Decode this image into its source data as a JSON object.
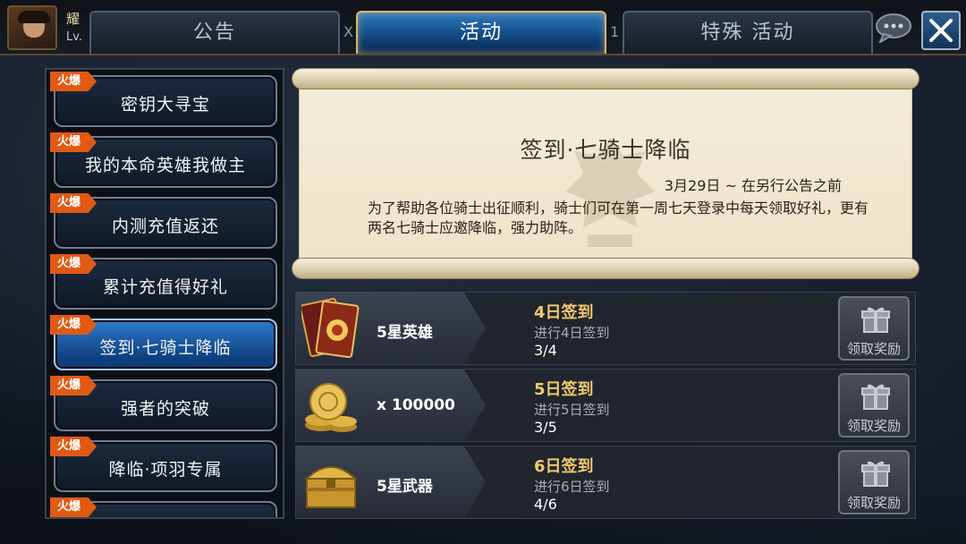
{
  "player": {
    "name": "耀",
    "level_prefix": "Lv."
  },
  "tabs": [
    {
      "label": "公告",
      "active": false
    },
    {
      "label": "活动",
      "active": true
    },
    {
      "label": "特殊 活动",
      "active": false
    }
  ],
  "tab_separators": [
    "X",
    "1"
  ],
  "hot_badge": "火爆",
  "events": [
    {
      "label": "密钥大寻宝",
      "selected": false
    },
    {
      "label": "我的本命英雄我做主",
      "selected": false
    },
    {
      "label": "内测充值返还",
      "selected": false
    },
    {
      "label": "累计充值得好礼",
      "selected": false
    },
    {
      "label": "签到·七骑士降临",
      "selected": true
    },
    {
      "label": "强者的突破",
      "selected": false
    },
    {
      "label": "降临·项羽专属",
      "selected": false
    },
    {
      "label": "",
      "selected": false
    }
  ],
  "detail": {
    "title": "签到·七骑士降临",
    "date": "3月29日 ~ 在另行公告之前",
    "description": "为了帮助各位骑士出征顺利，骑士们可在第一周七天登录中每天领取好礼，更有两名七骑士应邀降临，强力助阵。"
  },
  "rewards": [
    {
      "icon": "hero-card-icon",
      "name": "5星英雄",
      "title": "4日签到",
      "subtitle": "进行4日签到",
      "progress": "3/4",
      "claim_label": "领取奖励"
    },
    {
      "icon": "gold-coins-icon",
      "name": "x 100000",
      "title": "5日签到",
      "subtitle": "进行5日签到",
      "progress": "3/5",
      "claim_label": "领取奖励"
    },
    {
      "icon": "treasure-chest-icon",
      "name": "5星武器",
      "title": "6日签到",
      "subtitle": "进行6日签到",
      "progress": "4/6",
      "claim_label": "领取奖励"
    }
  ],
  "colors": {
    "accent_gold": "#f2c96b",
    "hot_badge": "#e05a14",
    "active_tab": "#2d7bc0"
  }
}
